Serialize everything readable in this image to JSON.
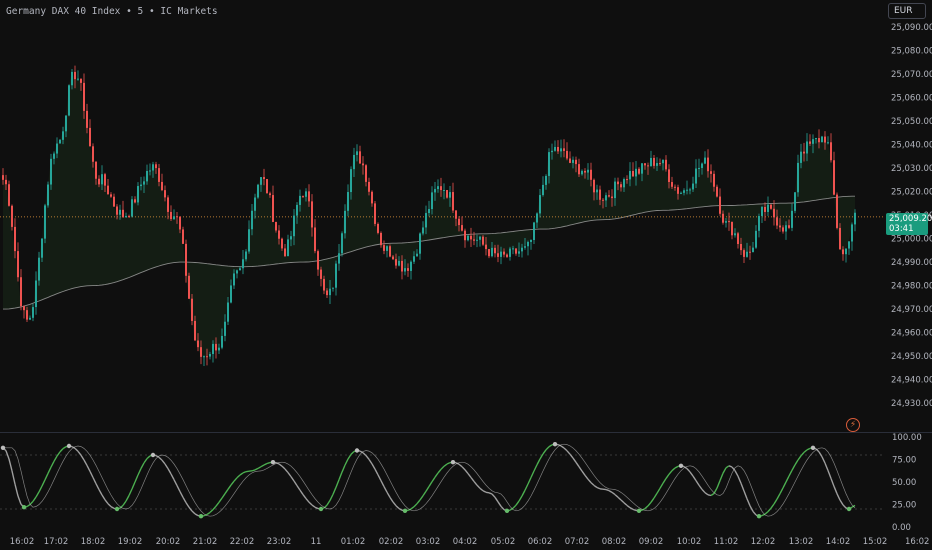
{
  "header": {
    "symbol_title": "Germany DAX 40 Index • 5 • IC Markets",
    "currency_button": "EUR"
  },
  "last_price": {
    "value": "25,009.20",
    "countdown": "03:41"
  },
  "colors": {
    "background": "#0f0f0f",
    "up": "#26a69a",
    "down": "#ef5350",
    "ma": "#b8b8b8",
    "price_line": "#e89a3c",
    "osc_up": "#4caf50",
    "osc_down": "#9e9e9e",
    "osc_dot_green": "#66bb6a",
    "osc_dot_grey": "#bdbdbd"
  },
  "chart_data": [
    {
      "type": "candlestick",
      "ylim": [
        24925,
        25095
      ],
      "y_ticks": [
        "25,090.00",
        "25,080.00",
        "25,070.00",
        "25,060.00",
        "25,050.00",
        "25,040.00",
        "25,030.00",
        "25,020.00",
        "25,010.00",
        "25,000.00",
        "24,990.00",
        "24,980.00",
        "24,970.00",
        "24,960.00",
        "24,950.00",
        "24,940.00",
        "24,930.00"
      ],
      "x_ticks": [
        "16:02",
        "17:02",
        "18:02",
        "19:02",
        "20:02",
        "21:02",
        "22:02",
        "23:02",
        "11",
        "01:02",
        "02:02",
        "03:02",
        "04:02",
        "05:02",
        "06:02",
        "07:02",
        "08:02",
        "09:02",
        "10:02",
        "11:02",
        "12:02",
        "13:02",
        "14:02",
        "15:02",
        "16:02"
      ],
      "close_anchors": [
        {
          "i": 0,
          "v": 25025
        },
        {
          "i": 8,
          "v": 24965
        },
        {
          "i": 18,
          "v": 25040
        },
        {
          "i": 24,
          "v": 25070
        },
        {
          "i": 32,
          "v": 25025
        },
        {
          "i": 40,
          "v": 25010
        },
        {
          "i": 50,
          "v": 25030
        },
        {
          "i": 57,
          "v": 25010
        },
        {
          "i": 66,
          "v": 24950
        },
        {
          "i": 72,
          "v": 24955
        },
        {
          "i": 78,
          "v": 24985
        },
        {
          "i": 86,
          "v": 25025
        },
        {
          "i": 94,
          "v": 24995
        },
        {
          "i": 100,
          "v": 25020
        },
        {
          "i": 108,
          "v": 24975
        },
        {
          "i": 118,
          "v": 25035
        },
        {
          "i": 128,
          "v": 24995
        },
        {
          "i": 134,
          "v": 24988
        },
        {
          "i": 146,
          "v": 25022
        },
        {
          "i": 156,
          "v": 25000
        },
        {
          "i": 166,
          "v": 24992
        },
        {
          "i": 174,
          "v": 24995
        },
        {
          "i": 184,
          "v": 25038
        },
        {
          "i": 192,
          "v": 25030
        },
        {
          "i": 200,
          "v": 25018
        },
        {
          "i": 210,
          "v": 25028
        },
        {
          "i": 218,
          "v": 25033
        },
        {
          "i": 226,
          "v": 25020
        },
        {
          "i": 234,
          "v": 25032
        },
        {
          "i": 242,
          "v": 25005
        },
        {
          "i": 248,
          "v": 24993
        },
        {
          "i": 254,
          "v": 25012
        },
        {
          "i": 262,
          "v": 25004
        },
        {
          "i": 266,
          "v": 25038
        },
        {
          "i": 274,
          "v": 25043
        },
        {
          "i": 280,
          "v": 24993
        },
        {
          "i": 284,
          "v": 25009
        }
      ],
      "ma_line": [
        {
          "i": 0,
          "v": 24970
        },
        {
          "i": 30,
          "v": 24980
        },
        {
          "i": 60,
          "v": 24990
        },
        {
          "i": 80,
          "v": 24988
        },
        {
          "i": 100,
          "v": 24990
        },
        {
          "i": 130,
          "v": 24998
        },
        {
          "i": 160,
          "v": 25002
        },
        {
          "i": 180,
          "v": 25004
        },
        {
          "i": 200,
          "v": 25008
        },
        {
          "i": 220,
          "v": 25012
        },
        {
          "i": 240,
          "v": 25014
        },
        {
          "i": 260,
          "v": 25015
        },
        {
          "i": 284,
          "v": 25018
        }
      ],
      "last_price_line": 25009.2
    },
    {
      "type": "line",
      "name": "oscillator",
      "ylim": [
        0,
        100
      ],
      "y_ticks": [
        "100.00",
        "75.00",
        "50.00",
        "25.00",
        "0.00"
      ],
      "dashed_levels": [
        80,
        20
      ],
      "anchors": [
        {
          "i": 0,
          "v": 88
        },
        {
          "i": 7,
          "v": 22
        },
        {
          "i": 22,
          "v": 90
        },
        {
          "i": 38,
          "v": 20
        },
        {
          "i": 50,
          "v": 80
        },
        {
          "i": 66,
          "v": 12
        },
        {
          "i": 82,
          "v": 62
        },
        {
          "i": 90,
          "v": 72
        },
        {
          "i": 106,
          "v": 20
        },
        {
          "i": 118,
          "v": 85
        },
        {
          "i": 134,
          "v": 18
        },
        {
          "i": 150,
          "v": 72
        },
        {
          "i": 162,
          "v": 38
        },
        {
          "i": 168,
          "v": 18
        },
        {
          "i": 184,
          "v": 92
        },
        {
          "i": 200,
          "v": 42
        },
        {
          "i": 212,
          "v": 18
        },
        {
          "i": 226,
          "v": 68
        },
        {
          "i": 236,
          "v": 35
        },
        {
          "i": 242,
          "v": 68
        },
        {
          "i": 252,
          "v": 12
        },
        {
          "i": 270,
          "v": 88
        },
        {
          "i": 282,
          "v": 20
        },
        {
          "i": 284,
          "v": 24
        }
      ],
      "dots": [
        {
          "i": 0,
          "v": 88,
          "c": "grey"
        },
        {
          "i": 7,
          "v": 22,
          "c": "green"
        },
        {
          "i": 22,
          "v": 90,
          "c": "grey"
        },
        {
          "i": 38,
          "v": 20,
          "c": "green"
        },
        {
          "i": 50,
          "v": 80,
          "c": "grey"
        },
        {
          "i": 66,
          "v": 12,
          "c": "green"
        },
        {
          "i": 90,
          "v": 72,
          "c": "grey"
        },
        {
          "i": 106,
          "v": 20,
          "c": "green"
        },
        {
          "i": 118,
          "v": 85,
          "c": "grey"
        },
        {
          "i": 134,
          "v": 18,
          "c": "green"
        },
        {
          "i": 150,
          "v": 72,
          "c": "grey"
        },
        {
          "i": 168,
          "v": 18,
          "c": "green"
        },
        {
          "i": 184,
          "v": 92,
          "c": "grey"
        },
        {
          "i": 212,
          "v": 18,
          "c": "green"
        },
        {
          "i": 226,
          "v": 68,
          "c": "grey"
        },
        {
          "i": 252,
          "v": 12,
          "c": "green"
        },
        {
          "i": 270,
          "v": 88,
          "c": "grey"
        },
        {
          "i": 282,
          "v": 20,
          "c": "green"
        }
      ]
    }
  ]
}
